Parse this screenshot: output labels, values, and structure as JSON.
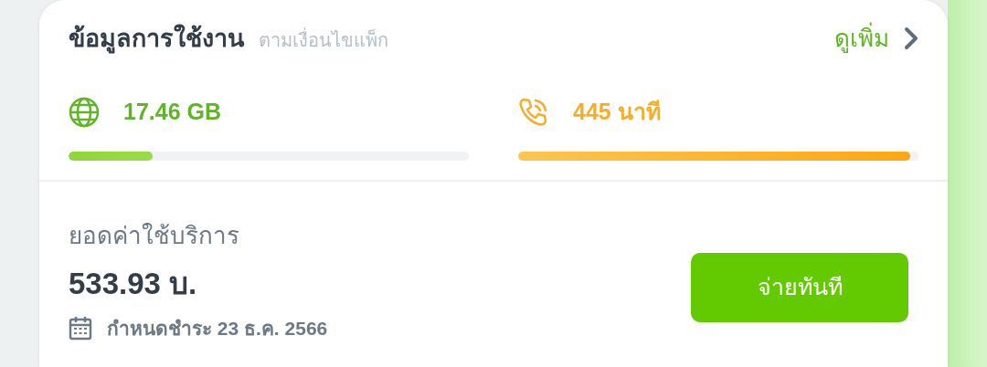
{
  "usage": {
    "title": "ข้อมูลการใช้งาน",
    "subtitle": "ตามเงื่อนไขแพ็ก",
    "more_link": "ดูเพิ่ม",
    "meters": [
      {
        "kind": "data",
        "reading": "17.46 GB",
        "level": 0.21
      },
      {
        "kind": "voice",
        "reading": "445 นาที",
        "level": 0.98
      }
    ]
  },
  "billing": {
    "label": "ยอดค่าใช้บริการ",
    "amount": "533.93 บ.",
    "due": "กำหนดชำระ 23 ธ.ค. 2566",
    "pay_button": "จ่ายทันที"
  }
}
